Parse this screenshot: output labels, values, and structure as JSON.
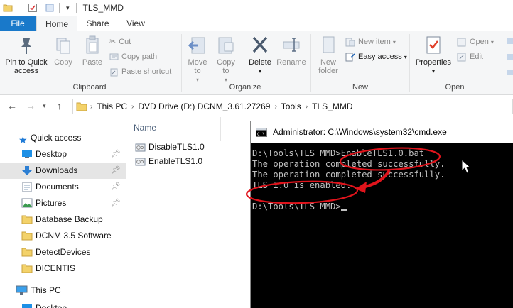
{
  "titlebar": {
    "title": "TLS_MMD"
  },
  "tabs": {
    "file": "File",
    "home": "Home",
    "share": "Share",
    "view": "View"
  },
  "ribbon": {
    "clipboard": {
      "pin": "Pin to Quick access",
      "copy": "Copy",
      "paste": "Paste",
      "cut": "Cut",
      "copy_path": "Copy path",
      "paste_shortcut": "Paste shortcut",
      "label": "Clipboard"
    },
    "organize": {
      "move_to": "Move to",
      "copy_to": "Copy to",
      "delete": "Delete",
      "rename": "Rename",
      "label": "Organize"
    },
    "new": {
      "new_folder": "New folder",
      "new_item": "New item",
      "easy_access": "Easy access",
      "label": "New"
    },
    "open": {
      "properties": "Properties",
      "open": "Open",
      "edit": "Edit",
      "label": "Open"
    }
  },
  "address": {
    "crumbs": [
      "This PC",
      "DVD Drive (D:) DCNM_3.61.27269",
      "Tools",
      "TLS_MMD"
    ]
  },
  "nav": {
    "quick_access": "Quick access",
    "desktop": "Desktop",
    "downloads": "Downloads",
    "documents": "Documents",
    "pictures": "Pictures",
    "database_backup": "Database Backup",
    "dcnm_software": "DCNM 3.5 Software",
    "detect_devices": "DetectDevices",
    "dicentis": "DICENTIS",
    "this_pc": "This PC",
    "desktop2": "Desktop"
  },
  "files": {
    "column_name": "Name",
    "items": [
      "DisableTLS1.0",
      "EnableTLS1.0"
    ]
  },
  "cmd": {
    "title": "Administrator: C:\\Windows\\system32\\cmd.exe",
    "lines": [
      "D:\\Tools\\TLS_MMD>EnableTLS1.0.bat",
      "The operation completed successfully.",
      "The operation completed successfully.",
      "TLS 1.0 is enabled.",
      "",
      "D:\\Tools\\TLS_MMD>"
    ]
  },
  "colors": {
    "accent": "#1979ca",
    "annotation": "#e0141c",
    "cmd_text": "#c0c0c0"
  }
}
